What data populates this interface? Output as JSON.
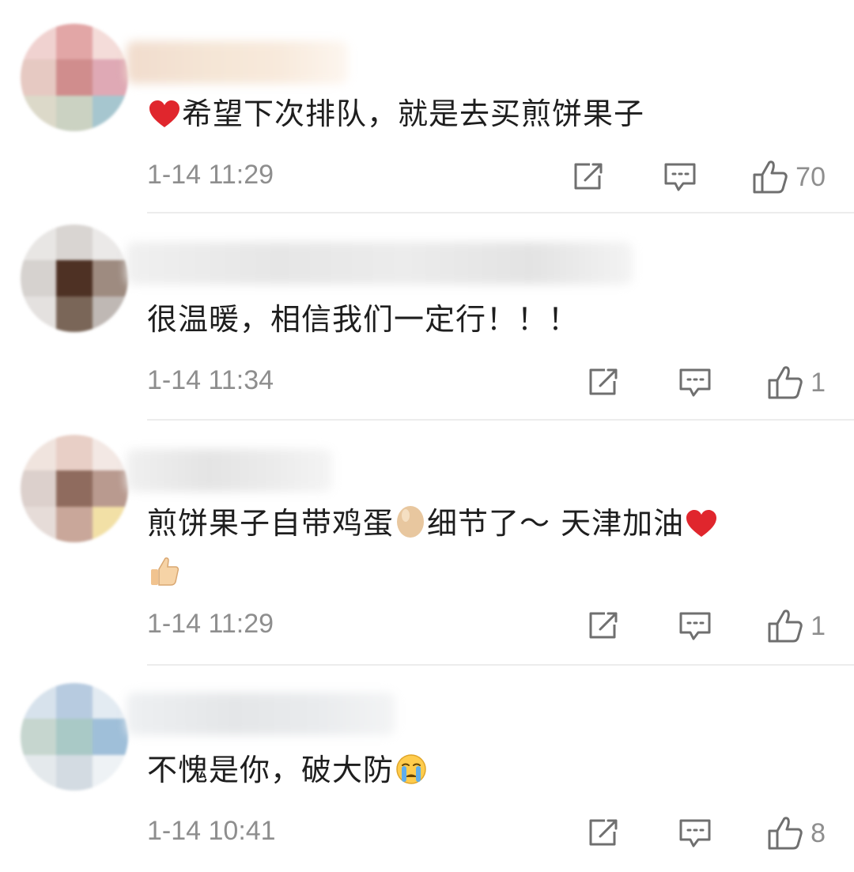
{
  "comments": [
    {
      "text": "希望下次排队，就是去买煎饼果子",
      "time": "1-14 11:29",
      "likes": "70",
      "leading_emoji": "heart-emoji",
      "trailing_emoji": []
    },
    {
      "text": "很温暖，相信我们一定行！！！",
      "time": "1-14 11:34",
      "likes": "1",
      "leading_emoji": null,
      "trailing_emoji": []
    },
    {
      "text_part1": "煎饼果子自带鸡蛋",
      "text_part2": "细节了～ 天津加油",
      "time": "1-14 11:29",
      "likes": "1",
      "emojis": [
        "egg-emoji",
        "heart-emoji",
        "thumbs-up-emoji"
      ]
    },
    {
      "text": "不愧是你，破大防",
      "time": "1-14 10:41",
      "likes": "8",
      "trailing_emoji": [
        "crying-emoji"
      ]
    }
  ],
  "icons": {
    "share": "share-icon",
    "reply": "comment-icon",
    "like": "thumbs-up-icon"
  },
  "colors": {
    "text": "#1e1e1e",
    "meta": "#8e8e8e",
    "icon": "#6f6f6f",
    "divider": "#ececec",
    "heart": "#e0262d"
  }
}
